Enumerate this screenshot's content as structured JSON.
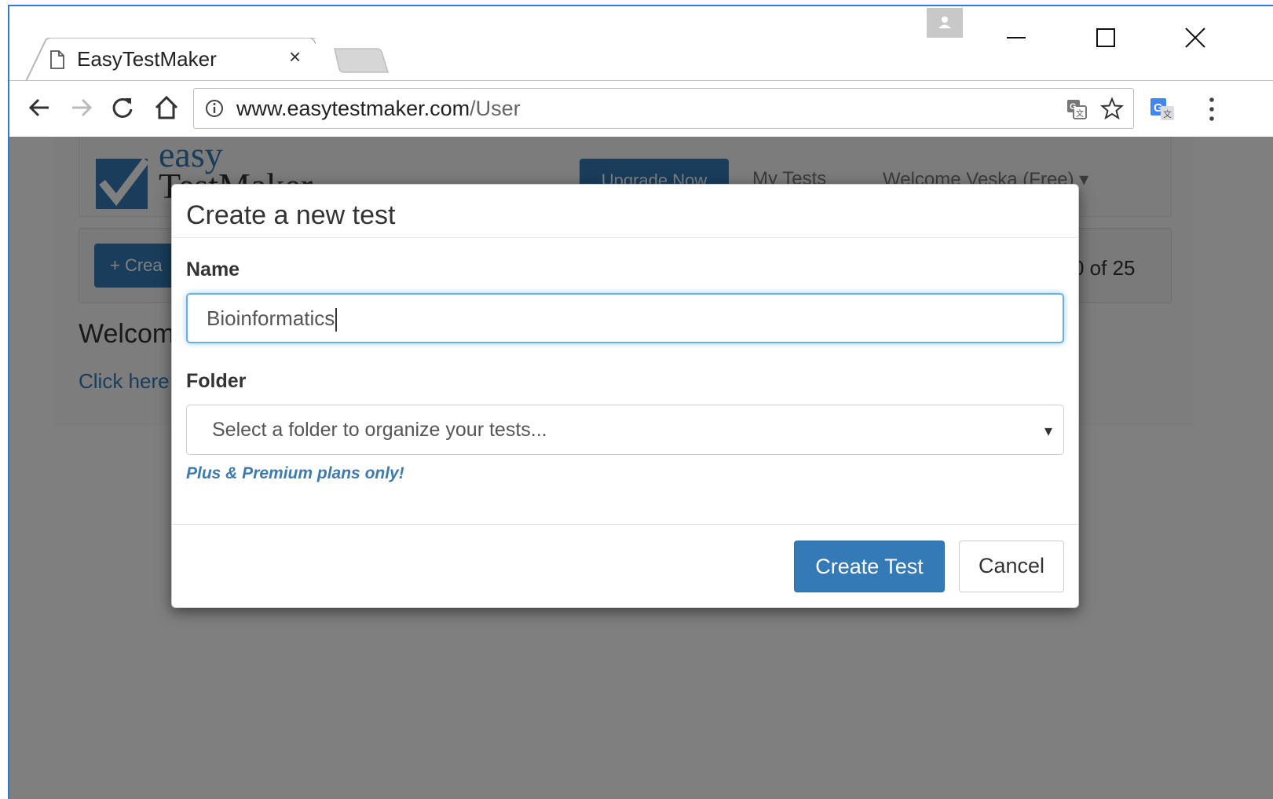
{
  "browser": {
    "tab_title": "EasyTestMaker",
    "tab_close": "×",
    "url_host": "www.easytestmaker.com",
    "url_path": "/User"
  },
  "site": {
    "logo_line1": "easy",
    "logo_line2": "TestMaker",
    "upgrade_label": "Upgrade Now",
    "my_tests_label": "My Tests",
    "welcome_user": "Welcome Veska (Free) ▾",
    "create_label": "+ Crea",
    "count_text": "0 of 25",
    "welcome_heading": "Welcom",
    "click_here": "Click here"
  },
  "modal": {
    "title": "Create a new test",
    "name_label": "Name",
    "name_value": "Bioinformatics",
    "folder_label": "Folder",
    "folder_placeholder": "Select a folder to organize your tests...",
    "folder_arrow": "▾",
    "plan_note": "Plus & Premium plans only!",
    "create_button": "Create Test",
    "cancel_button": "Cancel"
  },
  "colors": {
    "accent": "#337ab7",
    "focus_border": "#66afe9",
    "backdrop": "rgba(0,0,0,0.5)"
  },
  "icons": [
    "page-icon",
    "close-icon",
    "profile-icon",
    "minimize-icon",
    "maximize-icon",
    "window-close-icon",
    "back-icon",
    "forward-icon",
    "reload-icon",
    "home-icon",
    "info-icon",
    "translate-icon",
    "star-icon",
    "google-translate-icon",
    "more-menu-icon"
  ]
}
